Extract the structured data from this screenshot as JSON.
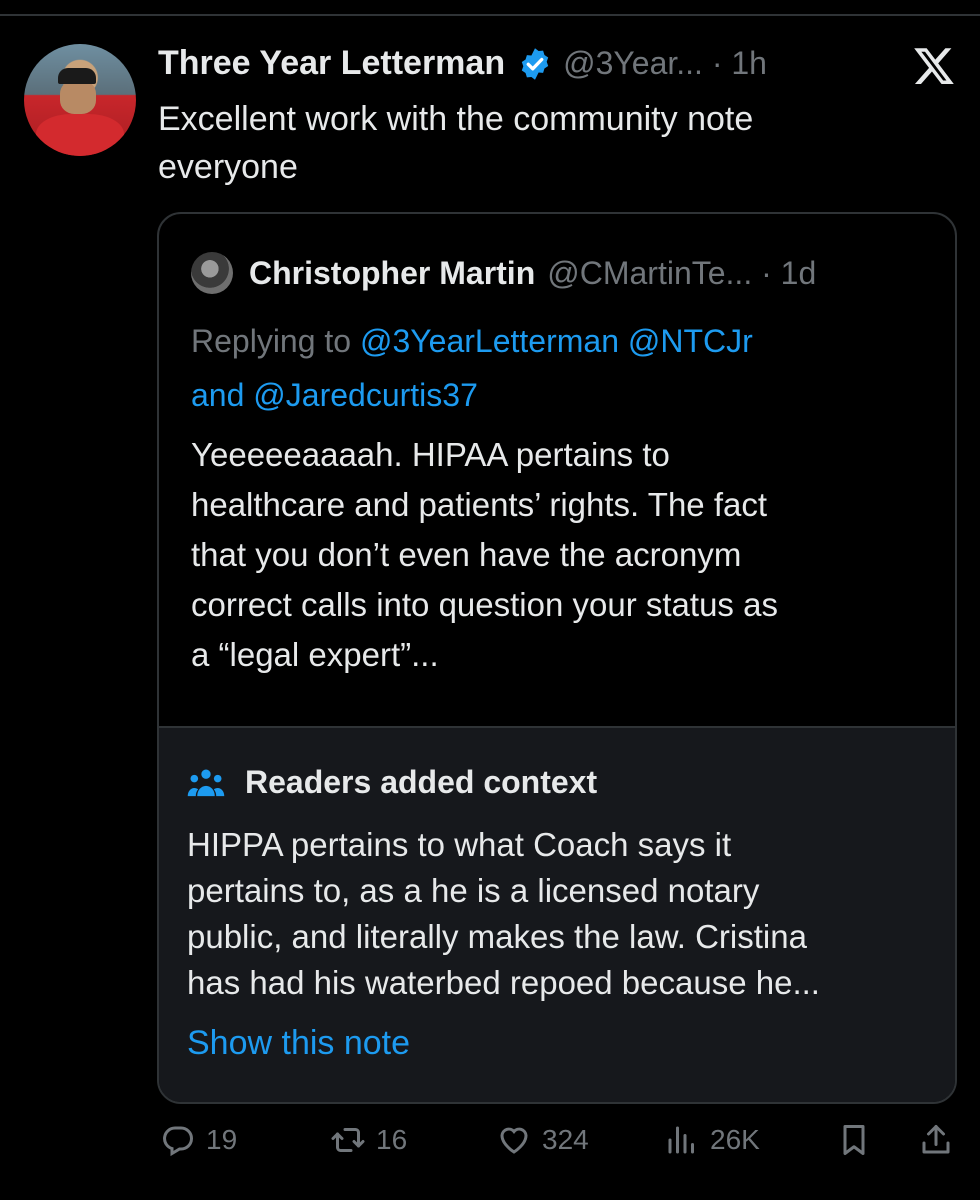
{
  "tweet": {
    "author_name": "Three Year Letterman",
    "handle_time": "@3Year... · 1h",
    "text_line1": "Excellent work with the community note",
    "text_line2": "everyone"
  },
  "quoted": {
    "author_name": "Christopher Martin",
    "handle_time": "@CMartinTe... · 1d",
    "replying_prefix": "Replying to ",
    "mention1": "@3YearLetterman",
    "mention2": "@NTCJr",
    "and_word": "and ",
    "mention3": "@Jaredcurtis37",
    "body_lines": [
      "Yeeeeeaaaah. HIPAA pertains to",
      "healthcare and patients’ rights. The fact",
      "that you don’t even have the acronym",
      "correct calls into question your status as",
      "a “legal expert”..."
    ]
  },
  "note": {
    "title": "Readers added context",
    "body_lines": [
      "HIPPA pertains to what Coach says it",
      "pertains to, as a he is a licensed notary",
      "public, and literally makes the law. Cristina",
      "has had his waterbed repoed because he..."
    ],
    "show_link": "Show this note"
  },
  "actions": {
    "replies": "19",
    "reposts": "16",
    "likes": "324",
    "views": "26K"
  },
  "icons": [
    "verified-icon",
    "x-logo-icon",
    "people-icon",
    "reply-icon",
    "repost-icon",
    "like-icon",
    "views-icon",
    "bookmark-icon",
    "share-icon"
  ],
  "colors": {
    "background": "#000000",
    "accent": "#1d9bf0",
    "muted": "#71767b",
    "note_bg": "#16181c",
    "border": "#2f3336"
  }
}
